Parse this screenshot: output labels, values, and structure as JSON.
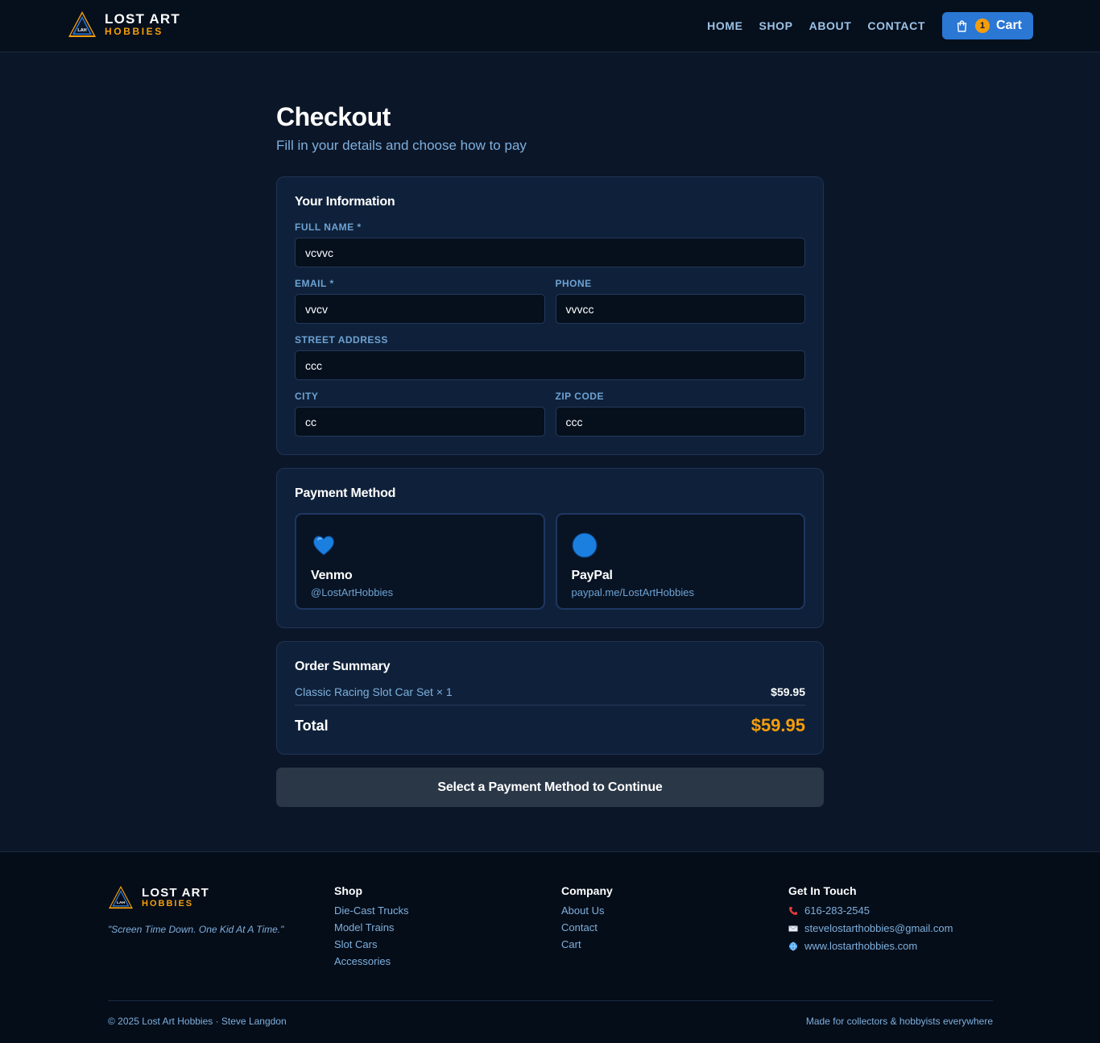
{
  "header": {
    "brand_top": "LOST ART",
    "brand_bottom": "HOBBIES",
    "logo_text": "LAH",
    "nav": [
      "HOME",
      "SHOP",
      "ABOUT",
      "CONTACT"
    ],
    "cart_count": "1",
    "cart_label": "Cart"
  },
  "checkout": {
    "title": "Checkout",
    "subtitle": "Fill in your details and choose how to pay"
  },
  "info": {
    "title": "Your Information",
    "full_name_label": "FULL NAME *",
    "full_name_value": "vcvvc",
    "email_label": "EMAIL *",
    "email_value": "vvcv",
    "phone_label": "PHONE",
    "phone_value": "vvvcc",
    "street_label": "STREET ADDRESS",
    "street_value": "ccc",
    "city_label": "CITY",
    "city_value": "cc",
    "zip_label": "ZIP CODE",
    "zip_value": "ccc"
  },
  "payment": {
    "title": "Payment Method",
    "options": [
      {
        "name": "Venmo",
        "handle": "@LostArtHobbies",
        "icon": "heart-icon",
        "color": "#1b7fe0"
      },
      {
        "name": "PayPal",
        "handle": "paypal.me/LostArtHobbies",
        "icon": "circle-icon",
        "color": "#1b7fe0"
      }
    ]
  },
  "summary": {
    "title": "Order Summary",
    "item": "Classic Racing Slot Car Set × 1",
    "item_price": "$59.95",
    "total_label": "Total",
    "total_value": "$59.95"
  },
  "continue_label": "Select a Payment Method to Continue",
  "footer": {
    "brand_top": "LOST ART",
    "brand_bottom": "HOBBIES",
    "tagline": "\"Screen Time Down. One Kid At A Time.\"",
    "shop_title": "Shop",
    "shop_links": [
      "Die-Cast Trucks",
      "Model Trains",
      "Slot Cars",
      "Accessories"
    ],
    "company_title": "Company",
    "company_links": [
      "About Us",
      "Contact",
      "Cart"
    ],
    "contact_title": "Get In Touch",
    "phone": "616-283-2545",
    "email": "stevelostarthobbies@gmail.com",
    "website": "www.lostarthobbies.com",
    "copyright": "© 2025 Lost Art Hobbies · Steve Langdon",
    "made_for": "Made for collectors & hobbyists everywhere"
  },
  "colors": {
    "accent": "#2a77d4",
    "orange": "#f59e0b",
    "background": "#0b1628"
  }
}
